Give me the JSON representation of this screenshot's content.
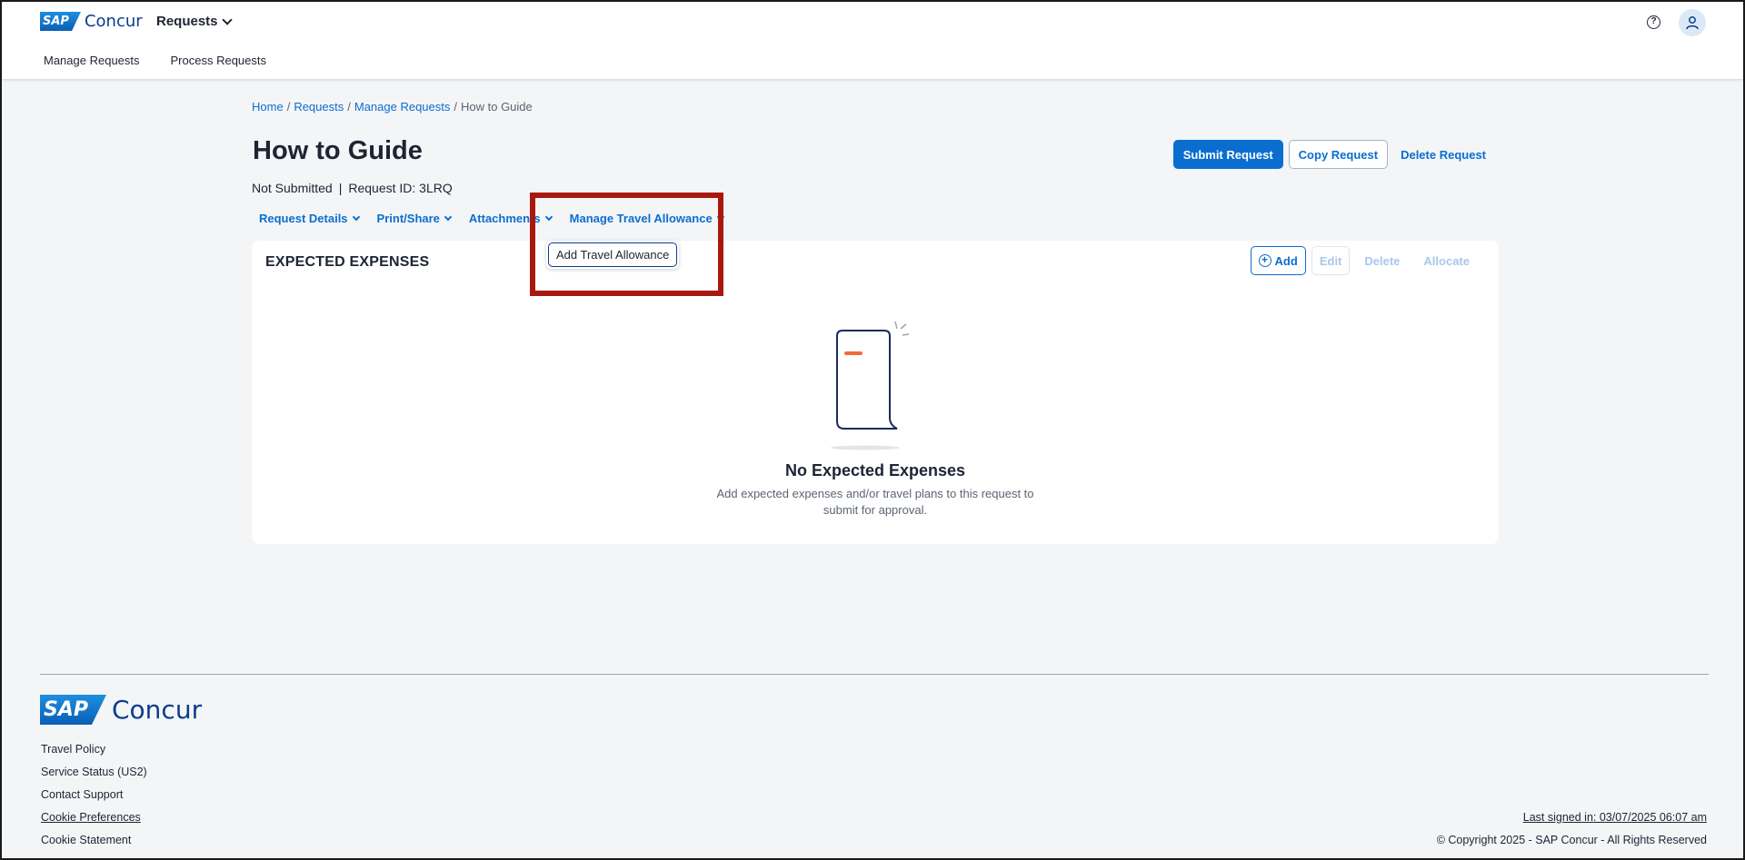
{
  "header": {
    "brand_badge": "SAP",
    "brand_name": "Concur",
    "module_menu": "Requests",
    "subnav": [
      "Manage Requests",
      "Process Requests"
    ]
  },
  "breadcrumb": [
    "Home",
    "Requests",
    "Manage Requests",
    "How to Guide"
  ],
  "page": {
    "title": "How to Guide",
    "status": "Not Submitted",
    "request_id": "Request ID: 3LRQ"
  },
  "actions": {
    "submit": "Submit Request",
    "copy": "Copy Request",
    "delete": "Delete Request"
  },
  "tabs": [
    "Request Details",
    "Print/Share",
    "Attachments",
    "Manage Travel Allowance"
  ],
  "dropdown": {
    "item": "Add Travel Allowance"
  },
  "card": {
    "title": "EXPECTED EXPENSES",
    "add": "Add",
    "edit": "Edit",
    "delete": "Delete",
    "allocate": "Allocate",
    "empty_title": "No Expected Expenses",
    "empty_desc": "Add expected expenses and/or travel plans to this request to submit for approval."
  },
  "footer": {
    "links": [
      "Travel Policy",
      "Service Status (US2)",
      "Contact Support",
      "Cookie Preferences",
      "Cookie Statement"
    ],
    "last_signed": "Last signed in: 03/07/2025 06:07 am",
    "copyright": "© Copyright 2025 - SAP Concur - All Rights Reserved"
  },
  "colors": {
    "accent": "#0a6ed1",
    "highlight": "#a8180f",
    "background": "#f4f5f7"
  }
}
